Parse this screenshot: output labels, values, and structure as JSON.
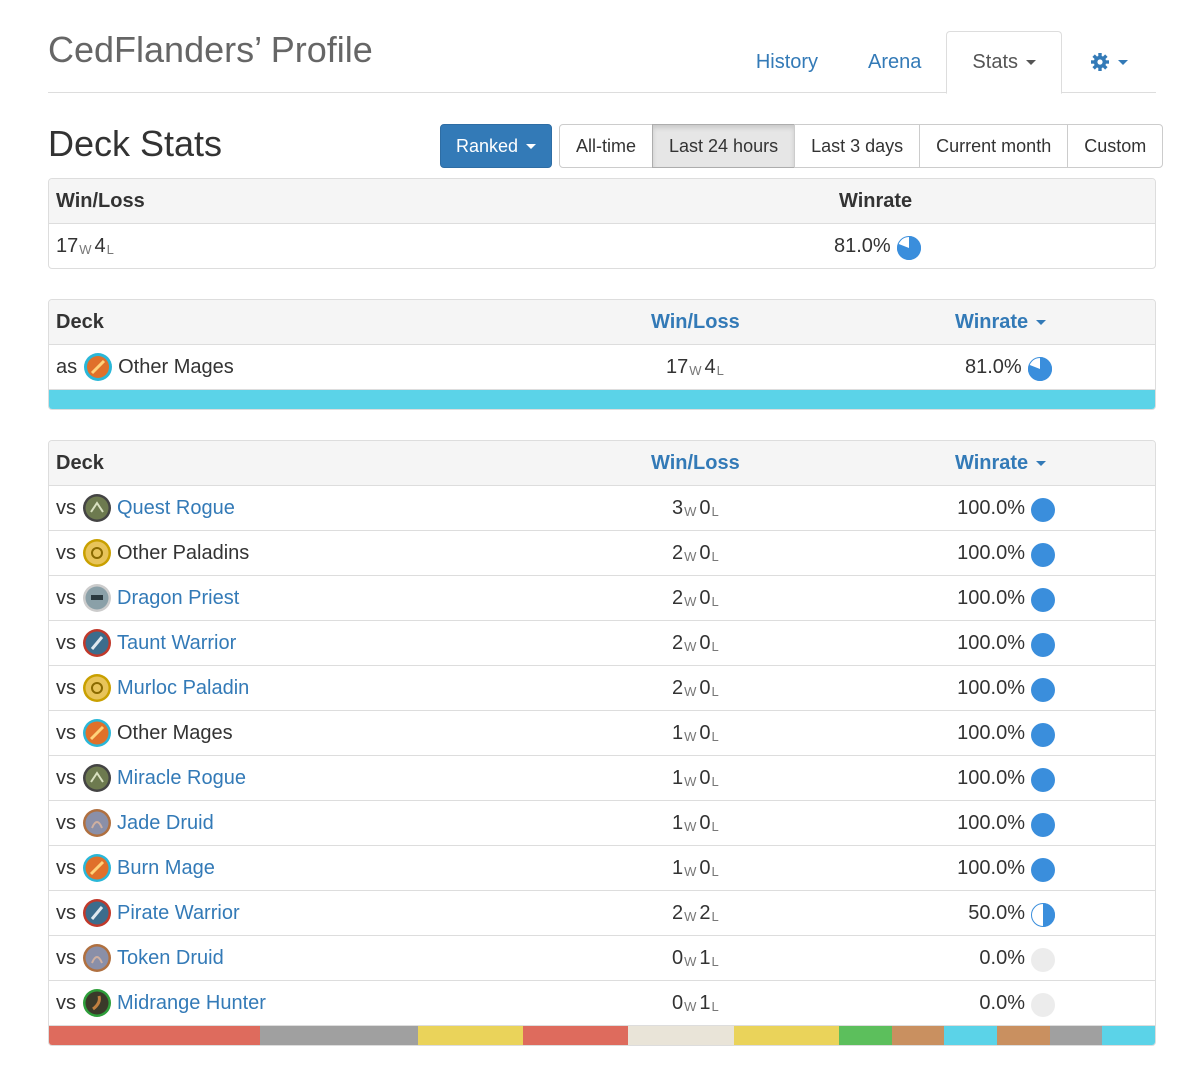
{
  "header": {
    "title": "CedFlanders’ Profile",
    "tabs": [
      {
        "label": "History",
        "active": false
      },
      {
        "label": "Arena",
        "active": false
      },
      {
        "label": "Stats",
        "active": true
      }
    ],
    "settings_icon": "gear-icon"
  },
  "stats": {
    "title": "Deck Stats",
    "mode_button": "Ranked",
    "ranges": [
      {
        "label": "All-time",
        "active": false
      },
      {
        "label": "Last 24 hours",
        "active": true
      },
      {
        "label": "Last 3 days",
        "active": false
      },
      {
        "label": "Current month",
        "active": false
      },
      {
        "label": "Custom",
        "active": false
      }
    ]
  },
  "summary": {
    "col_winloss": "Win/Loss",
    "col_winrate": "Winrate",
    "wins": "17",
    "losses": "4",
    "winrate": "81.0%",
    "winrate_value": 0.81
  },
  "labels": {
    "w": "W",
    "l": "L"
  },
  "own_deck": {
    "col_deck": "Deck",
    "col_winloss": "Win/Loss",
    "col_winrate": "Winrate",
    "prefix": "as",
    "name": "Other Mages",
    "wins": "17",
    "losses": "4",
    "winrate": "81.0%",
    "winrate_value": 0.81,
    "bar_color": "#5bd3e8"
  },
  "opponents": {
    "col_deck": "Deck",
    "col_winloss": "Win/Loss",
    "col_winrate": "Winrate",
    "rows": [
      {
        "prefix": "vs",
        "name": "Quest Rogue",
        "link": true,
        "icon": "rogue-class-icon",
        "icon_color": "#6d7a4f",
        "ring": "#444444",
        "wins": "3",
        "losses": "0",
        "winrate": "100.0%",
        "winrate_value": 1.0
      },
      {
        "prefix": "vs",
        "name": "Other Paladins",
        "link": false,
        "icon": "paladin-class-icon",
        "icon_color": "#e8c45a",
        "ring": "#c9a000",
        "wins": "2",
        "losses": "0",
        "winrate": "100.0%",
        "winrate_value": 1.0
      },
      {
        "prefix": "vs",
        "name": "Dragon Priest",
        "link": true,
        "icon": "priest-class-icon",
        "icon_color": "#8aa0a8",
        "ring": "#cccccc",
        "wins": "2",
        "losses": "0",
        "winrate": "100.0%",
        "winrate_value": 1.0
      },
      {
        "prefix": "vs",
        "name": "Taunt Warrior",
        "link": true,
        "icon": "warrior-class-icon",
        "icon_color": "#3b6c8c",
        "ring": "#c0392b",
        "wins": "2",
        "losses": "0",
        "winrate": "100.0%",
        "winrate_value": 1.0
      },
      {
        "prefix": "vs",
        "name": "Murloc Paladin",
        "link": true,
        "icon": "paladin-class-icon",
        "icon_color": "#e8c45a",
        "ring": "#c9a000",
        "wins": "2",
        "losses": "0",
        "winrate": "100.0%",
        "winrate_value": 1.0
      },
      {
        "prefix": "vs",
        "name": "Other Mages",
        "link": false,
        "icon": "mage-class-icon",
        "icon_color": "#e0702a",
        "ring": "#2ab7d8",
        "wins": "1",
        "losses": "0",
        "winrate": "100.0%",
        "winrate_value": 1.0
      },
      {
        "prefix": "vs",
        "name": "Miracle Rogue",
        "link": true,
        "icon": "rogue-class-icon",
        "icon_color": "#6d7a4f",
        "ring": "#444444",
        "wins": "1",
        "losses": "0",
        "winrate": "100.0%",
        "winrate_value": 1.0
      },
      {
        "prefix": "vs",
        "name": "Jade Druid",
        "link": true,
        "icon": "druid-class-icon",
        "icon_color": "#8a8fa8",
        "ring": "#b07040",
        "wins": "1",
        "losses": "0",
        "winrate": "100.0%",
        "winrate_value": 1.0
      },
      {
        "prefix": "vs",
        "name": "Burn Mage",
        "link": true,
        "icon": "mage-class-icon",
        "icon_color": "#e0702a",
        "ring": "#2ab7d8",
        "wins": "1",
        "losses": "0",
        "winrate": "100.0%",
        "winrate_value": 1.0
      },
      {
        "prefix": "vs",
        "name": "Pirate Warrior",
        "link": true,
        "icon": "warrior-class-icon",
        "icon_color": "#3b6c8c",
        "ring": "#c0392b",
        "wins": "2",
        "losses": "2",
        "winrate": "50.0%",
        "winrate_value": 0.5
      },
      {
        "prefix": "vs",
        "name": "Token Druid",
        "link": true,
        "icon": "druid-class-icon",
        "icon_color": "#8a8fa8",
        "ring": "#b07040",
        "wins": "0",
        "losses": "1",
        "winrate": "0.0%",
        "winrate_value": 0.0
      },
      {
        "prefix": "vs",
        "name": "Midrange Hunter",
        "link": true,
        "icon": "hunter-class-icon",
        "icon_color": "#3a3a2a",
        "ring": "#2e9e3a",
        "wins": "0",
        "losses": "1",
        "winrate": "0.0%",
        "winrate_value": 0.0
      }
    ],
    "class_bar": [
      {
        "color": "#de6b5d",
        "share": 4
      },
      {
        "color": "#a0a0a0",
        "share": 3
      },
      {
        "color": "#ead35a",
        "share": 2
      },
      {
        "color": "#de6b5d",
        "share": 2
      },
      {
        "color": "#e9e4d8",
        "share": 2
      },
      {
        "color": "#ead35a",
        "share": 2
      },
      {
        "color": "#5cbf5c",
        "share": 1
      },
      {
        "color": "#c99060",
        "share": 1
      },
      {
        "color": "#5bd3e8",
        "share": 1
      },
      {
        "color": "#c99060",
        "share": 1
      },
      {
        "color": "#a0a0a0",
        "share": 1
      },
      {
        "color": "#5bd3e8",
        "share": 1
      }
    ]
  },
  "colors": {
    "link": "#337ab7",
    "pie_fill": "#3a8edc",
    "pie_empty": "#ececec"
  }
}
